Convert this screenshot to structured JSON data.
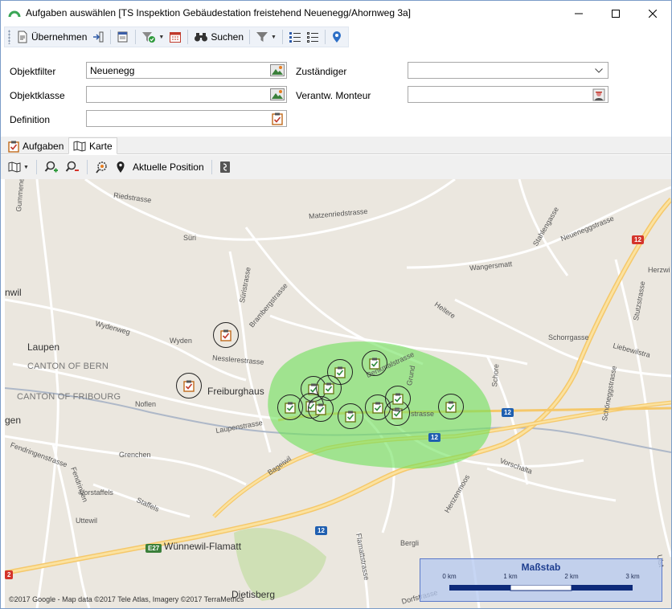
{
  "window": {
    "title": "Aufgaben auswählen [TS Inspektion Gebäudestation freistehend Neuenegg/Ahornweg 3a]"
  },
  "toolbar": {
    "apply_label": "Übernehmen",
    "search_label": "Suchen"
  },
  "form": {
    "objektfilter_label": "Objektfilter",
    "objektfilter_value": "Neuenegg",
    "objektklasse_label": "Objektklasse",
    "objektklasse_value": "",
    "definition_label": "Definition",
    "definition_value": "",
    "zustaendiger_label": "Zuständiger",
    "zustaendiger_value": "",
    "monteur_label": "Verantw. Monteur",
    "monteur_value": ""
  },
  "tabs": [
    {
      "label": "Aufgaben",
      "active": false
    },
    {
      "label": "Karte",
      "active": true
    }
  ],
  "map_toolbar": {
    "position_label": "Aktuelle Position"
  },
  "map": {
    "places": {
      "laupen": "Laupen",
      "freiburghaus": "Freiburghaus",
      "wuennewil": "Wünnewil-Flamatt",
      "canton_bern": "CANTON OF BERN",
      "canton_fribourg": "CANTON OF FRIBOURG",
      "wil": "nwil",
      "gen": "gen",
      "dietisberg": "Dietisberg"
    },
    "streets": {
      "gummenenst": "Gummenenst",
      "riedstrasse": "Riedstrasse",
      "suri": "Süri",
      "matzenried": "Matzenriedstrasse",
      "stahlengasse": "Stahlengasse",
      "neueneggstrasse": "Neueneggstrasse",
      "wangersmatt": "Wangersmatt",
      "suristrasse": "Süristrasse",
      "brambergstrasse": "Brambergstrasse",
      "wydenweg": "Wydenweg",
      "wyden": "Wyden",
      "nesslerestrasse": "Nesslerestrasse",
      "heitere": "Heitere",
      "schorrgasse": "Schorrgasse",
      "herzwil": "Herzwi",
      "stutzstrasse": "Stutzstrasse",
      "liebewilstrasse": "Liebewilstra",
      "schoenegg": "Schöneggstrasse",
      "schore": "Schore",
      "denkmalstrasse": "Denkmalstrasse",
      "grund": "Grund",
      "noflen": "Noflen",
      "laupenstrasse": "Laupenstrasse",
      "bageiwil": "Bageiwil",
      "grenchen": "Grenchen",
      "fendringenstrasse": "Fendringenstrasse",
      "fendringen": "Fendringen",
      "vorstaffels": "Vorstaffels",
      "staffels": "Staffels",
      "uttewil": "Uttewil",
      "vorschalta": "Vorschalta",
      "henzenmoos": "Henzenmoos",
      "flamattstrasse": "Flamattstrasse",
      "bergli": "Bergli",
      "dorfstrasse": "Dorfstrasse",
      "ulst": "Ulst",
      "strasse": "strasse"
    },
    "shields": {
      "r12a": "12",
      "r12b": "12",
      "r12c": "12",
      "r12d": "12",
      "e27": "E27",
      "r2": "2"
    },
    "copyright": "©2017 Google - Map data ©2017 Tele Atlas, Imagery ©2017 TerraMetrics",
    "scale": {
      "title": "Maßstab",
      "labels": [
        "0 km",
        "1 km",
        "2 km",
        "3 km"
      ]
    }
  }
}
